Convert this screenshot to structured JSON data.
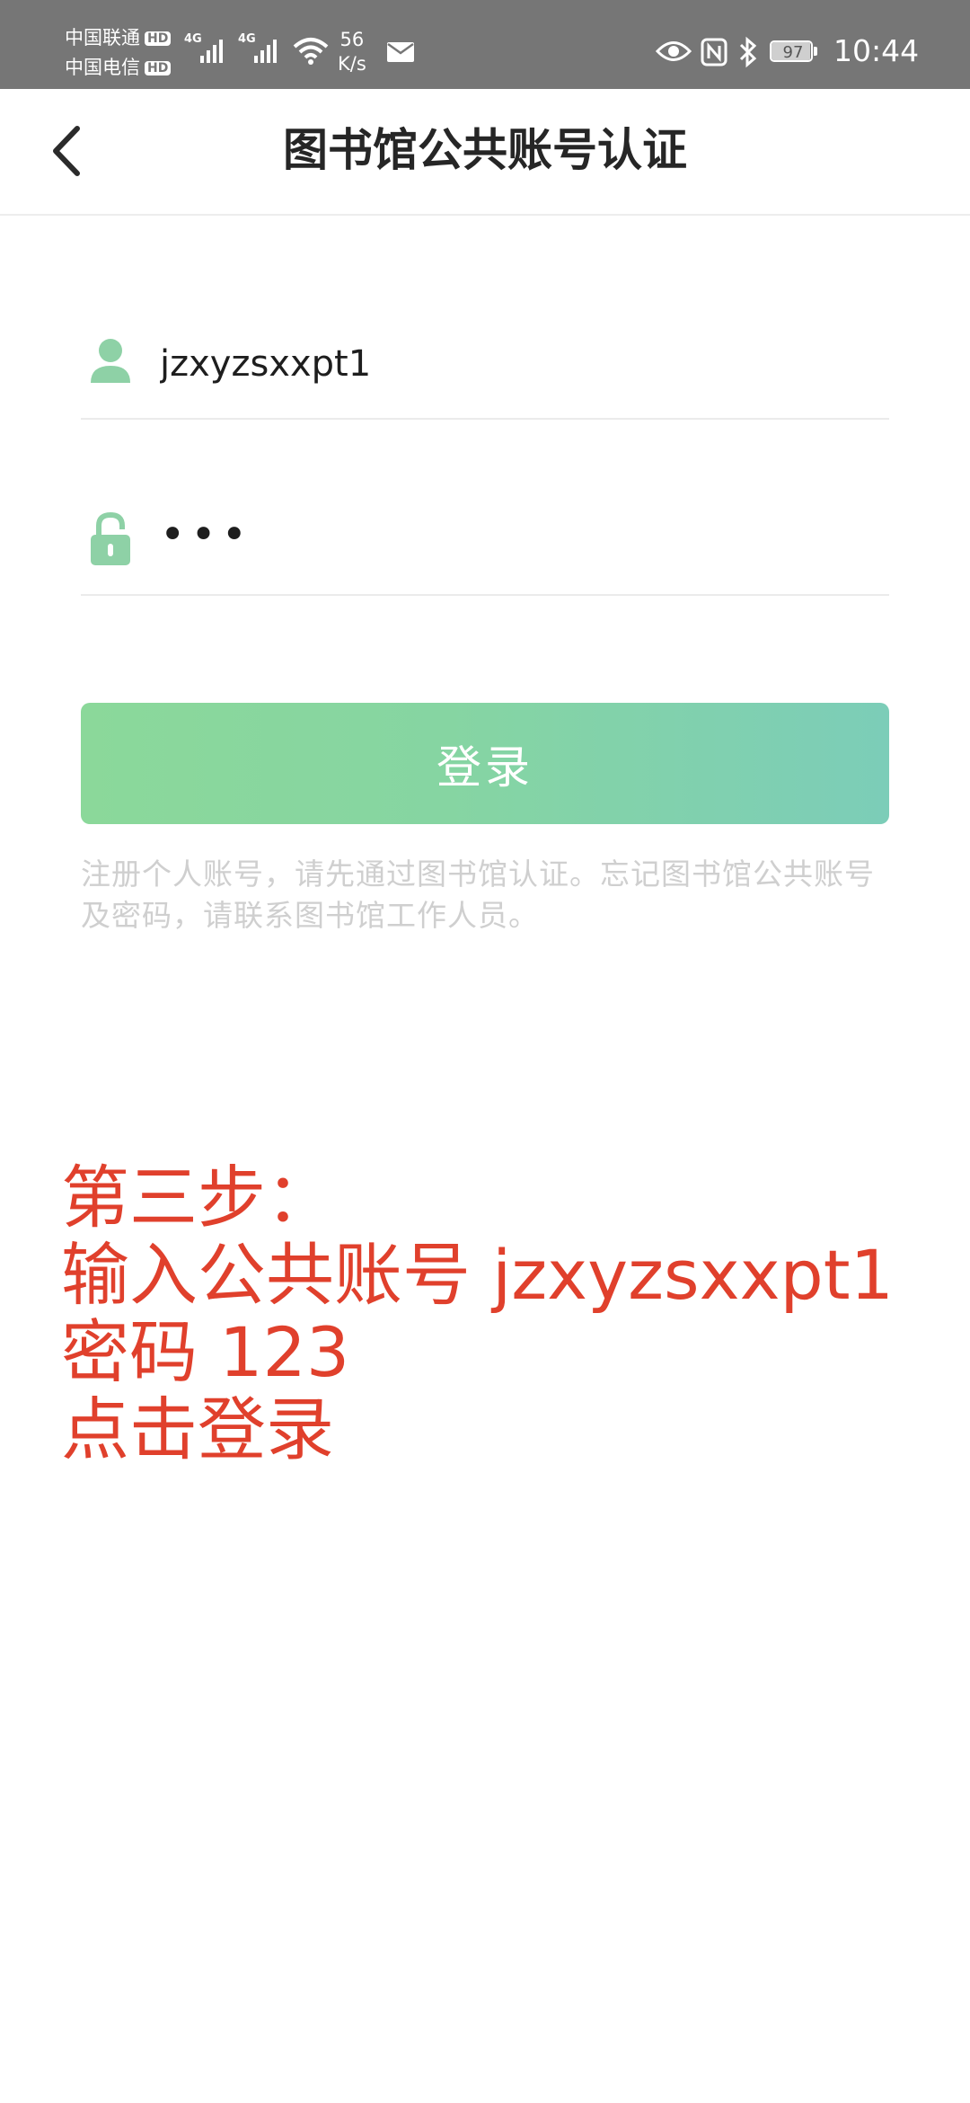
{
  "status_bar": {
    "carrier_1": "中国联通",
    "carrier_2": "中国电信",
    "hd_badge": "HD",
    "network_type": "4G",
    "net_speed_value": "56",
    "net_speed_unit": "K/s",
    "battery_level": "97",
    "time": "10:44"
  },
  "header": {
    "title": "图书馆公共账号认证",
    "back_icon": "chevron-left-icon"
  },
  "form": {
    "username_value": "jzxyzsxxpt1",
    "password_value": "•••",
    "login_label": "登录",
    "hint": "注册个人账号，请先通过图书馆认证。忘记图书馆公共账号及密码，请联系图书馆工作人员。",
    "accent_color": "#8bd2a6"
  },
  "annotation": {
    "line_1": "第三步：",
    "line_2": "输入公共账号 jzxyzsxxpt1",
    "line_3": "密码 123",
    "line_4": "点击登录",
    "color": "#e0402c"
  }
}
